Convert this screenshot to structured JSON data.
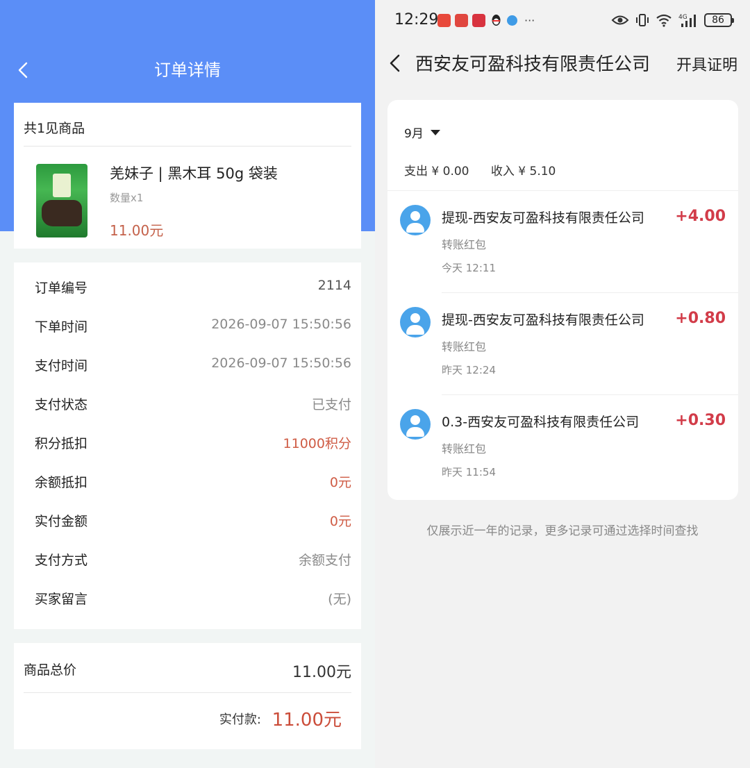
{
  "left": {
    "title": "订单详情",
    "goods": {
      "count_label": "共1见商品",
      "name": "羌妹子 | 黑木耳 50g 袋装",
      "qty": "数量x1",
      "price": "11.00元"
    },
    "info_rows": [
      {
        "label": "订单编号",
        "value": "2114"
      },
      {
        "label": "下单时间",
        "value": "2026-09-07 15:50:56"
      },
      {
        "label": "支付时间",
        "value": "2026-09-07 15:50:56"
      },
      {
        "label": "支付状态",
        "value": "已支付"
      },
      {
        "label": "积分抵扣",
        "value": "11000积分"
      },
      {
        "label": "余额抵扣",
        "value": "0元"
      },
      {
        "label": "实付金额",
        "value": "0元"
      },
      {
        "label": "支付方式",
        "value": "余额支付"
      },
      {
        "label": "买家留言",
        "value": "(无)"
      }
    ],
    "total": {
      "label": "商品总价",
      "value": "11.00元",
      "pay_label": "实付款:",
      "pay_value": "11.00元"
    },
    "colors": {
      "header_blue": "#5b8ef7",
      "price_red": "#c4614a"
    }
  },
  "right": {
    "status_bar": {
      "time": "12:29",
      "more": "···",
      "battery": "86",
      "network": "4G"
    },
    "app_icons": [
      "red-app-icon",
      "red-app-icon",
      "red-app-icon",
      "qq-icon",
      "blue-app-icon"
    ],
    "nav": {
      "company": "西安友可盈科技有限责任公司",
      "cert": "开具证明"
    },
    "month": "9月",
    "summary": {
      "expense": "支出 ¥ 0.00",
      "income": "收入 ¥ 5.10"
    },
    "transactions": [
      {
        "title": "提现-西安友可盈科技有限责任公司",
        "amount": "+4.00",
        "type": "转账红包",
        "time": "今天 12:11"
      },
      {
        "title": "提现-西安友可盈科技有限责任公司",
        "amount": "+0.80",
        "type": "转账红包",
        "time": "昨天 12:24"
      },
      {
        "title": "0.3-西安友可盈科技有限责任公司",
        "amount": "+0.30",
        "type": "转账红包",
        "time": "昨天 11:54"
      }
    ],
    "note": "仅展示近一年的记录，更多记录可通过选择时间查找",
    "colors": {
      "amount_red": "#d23c49",
      "avatar_blue": "#4aa4ea"
    }
  }
}
